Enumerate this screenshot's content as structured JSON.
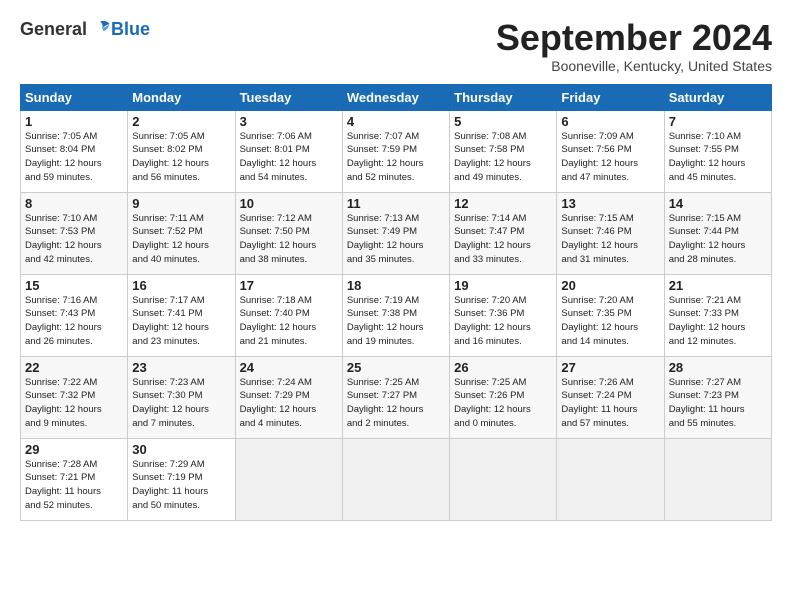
{
  "header": {
    "logo_general": "General",
    "logo_blue": "Blue",
    "title": "September 2024",
    "location": "Booneville, Kentucky, United States"
  },
  "columns": [
    "Sunday",
    "Monday",
    "Tuesday",
    "Wednesday",
    "Thursday",
    "Friday",
    "Saturday"
  ],
  "weeks": [
    [
      {
        "day": "1",
        "info": "Sunrise: 7:05 AM\nSunset: 8:04 PM\nDaylight: 12 hours\nand 59 minutes."
      },
      {
        "day": "2",
        "info": "Sunrise: 7:05 AM\nSunset: 8:02 PM\nDaylight: 12 hours\nand 56 minutes."
      },
      {
        "day": "3",
        "info": "Sunrise: 7:06 AM\nSunset: 8:01 PM\nDaylight: 12 hours\nand 54 minutes."
      },
      {
        "day": "4",
        "info": "Sunrise: 7:07 AM\nSunset: 7:59 PM\nDaylight: 12 hours\nand 52 minutes."
      },
      {
        "day": "5",
        "info": "Sunrise: 7:08 AM\nSunset: 7:58 PM\nDaylight: 12 hours\nand 49 minutes."
      },
      {
        "day": "6",
        "info": "Sunrise: 7:09 AM\nSunset: 7:56 PM\nDaylight: 12 hours\nand 47 minutes."
      },
      {
        "day": "7",
        "info": "Sunrise: 7:10 AM\nSunset: 7:55 PM\nDaylight: 12 hours\nand 45 minutes."
      }
    ],
    [
      {
        "day": "8",
        "info": "Sunrise: 7:10 AM\nSunset: 7:53 PM\nDaylight: 12 hours\nand 42 minutes."
      },
      {
        "day": "9",
        "info": "Sunrise: 7:11 AM\nSunset: 7:52 PM\nDaylight: 12 hours\nand 40 minutes."
      },
      {
        "day": "10",
        "info": "Sunrise: 7:12 AM\nSunset: 7:50 PM\nDaylight: 12 hours\nand 38 minutes."
      },
      {
        "day": "11",
        "info": "Sunrise: 7:13 AM\nSunset: 7:49 PM\nDaylight: 12 hours\nand 35 minutes."
      },
      {
        "day": "12",
        "info": "Sunrise: 7:14 AM\nSunset: 7:47 PM\nDaylight: 12 hours\nand 33 minutes."
      },
      {
        "day": "13",
        "info": "Sunrise: 7:15 AM\nSunset: 7:46 PM\nDaylight: 12 hours\nand 31 minutes."
      },
      {
        "day": "14",
        "info": "Sunrise: 7:15 AM\nSunset: 7:44 PM\nDaylight: 12 hours\nand 28 minutes."
      }
    ],
    [
      {
        "day": "15",
        "info": "Sunrise: 7:16 AM\nSunset: 7:43 PM\nDaylight: 12 hours\nand 26 minutes."
      },
      {
        "day": "16",
        "info": "Sunrise: 7:17 AM\nSunset: 7:41 PM\nDaylight: 12 hours\nand 23 minutes."
      },
      {
        "day": "17",
        "info": "Sunrise: 7:18 AM\nSunset: 7:40 PM\nDaylight: 12 hours\nand 21 minutes."
      },
      {
        "day": "18",
        "info": "Sunrise: 7:19 AM\nSunset: 7:38 PM\nDaylight: 12 hours\nand 19 minutes."
      },
      {
        "day": "19",
        "info": "Sunrise: 7:20 AM\nSunset: 7:36 PM\nDaylight: 12 hours\nand 16 minutes."
      },
      {
        "day": "20",
        "info": "Sunrise: 7:20 AM\nSunset: 7:35 PM\nDaylight: 12 hours\nand 14 minutes."
      },
      {
        "day": "21",
        "info": "Sunrise: 7:21 AM\nSunset: 7:33 PM\nDaylight: 12 hours\nand 12 minutes."
      }
    ],
    [
      {
        "day": "22",
        "info": "Sunrise: 7:22 AM\nSunset: 7:32 PM\nDaylight: 12 hours\nand 9 minutes."
      },
      {
        "day": "23",
        "info": "Sunrise: 7:23 AM\nSunset: 7:30 PM\nDaylight: 12 hours\nand 7 minutes."
      },
      {
        "day": "24",
        "info": "Sunrise: 7:24 AM\nSunset: 7:29 PM\nDaylight: 12 hours\nand 4 minutes."
      },
      {
        "day": "25",
        "info": "Sunrise: 7:25 AM\nSunset: 7:27 PM\nDaylight: 12 hours\nand 2 minutes."
      },
      {
        "day": "26",
        "info": "Sunrise: 7:25 AM\nSunset: 7:26 PM\nDaylight: 12 hours\nand 0 minutes."
      },
      {
        "day": "27",
        "info": "Sunrise: 7:26 AM\nSunset: 7:24 PM\nDaylight: 11 hours\nand 57 minutes."
      },
      {
        "day": "28",
        "info": "Sunrise: 7:27 AM\nSunset: 7:23 PM\nDaylight: 11 hours\nand 55 minutes."
      }
    ],
    [
      {
        "day": "29",
        "info": "Sunrise: 7:28 AM\nSunset: 7:21 PM\nDaylight: 11 hours\nand 52 minutes."
      },
      {
        "day": "30",
        "info": "Sunrise: 7:29 AM\nSunset: 7:19 PM\nDaylight: 11 hours\nand 50 minutes."
      },
      {
        "day": "",
        "info": ""
      },
      {
        "day": "",
        "info": ""
      },
      {
        "day": "",
        "info": ""
      },
      {
        "day": "",
        "info": ""
      },
      {
        "day": "",
        "info": ""
      }
    ]
  ]
}
